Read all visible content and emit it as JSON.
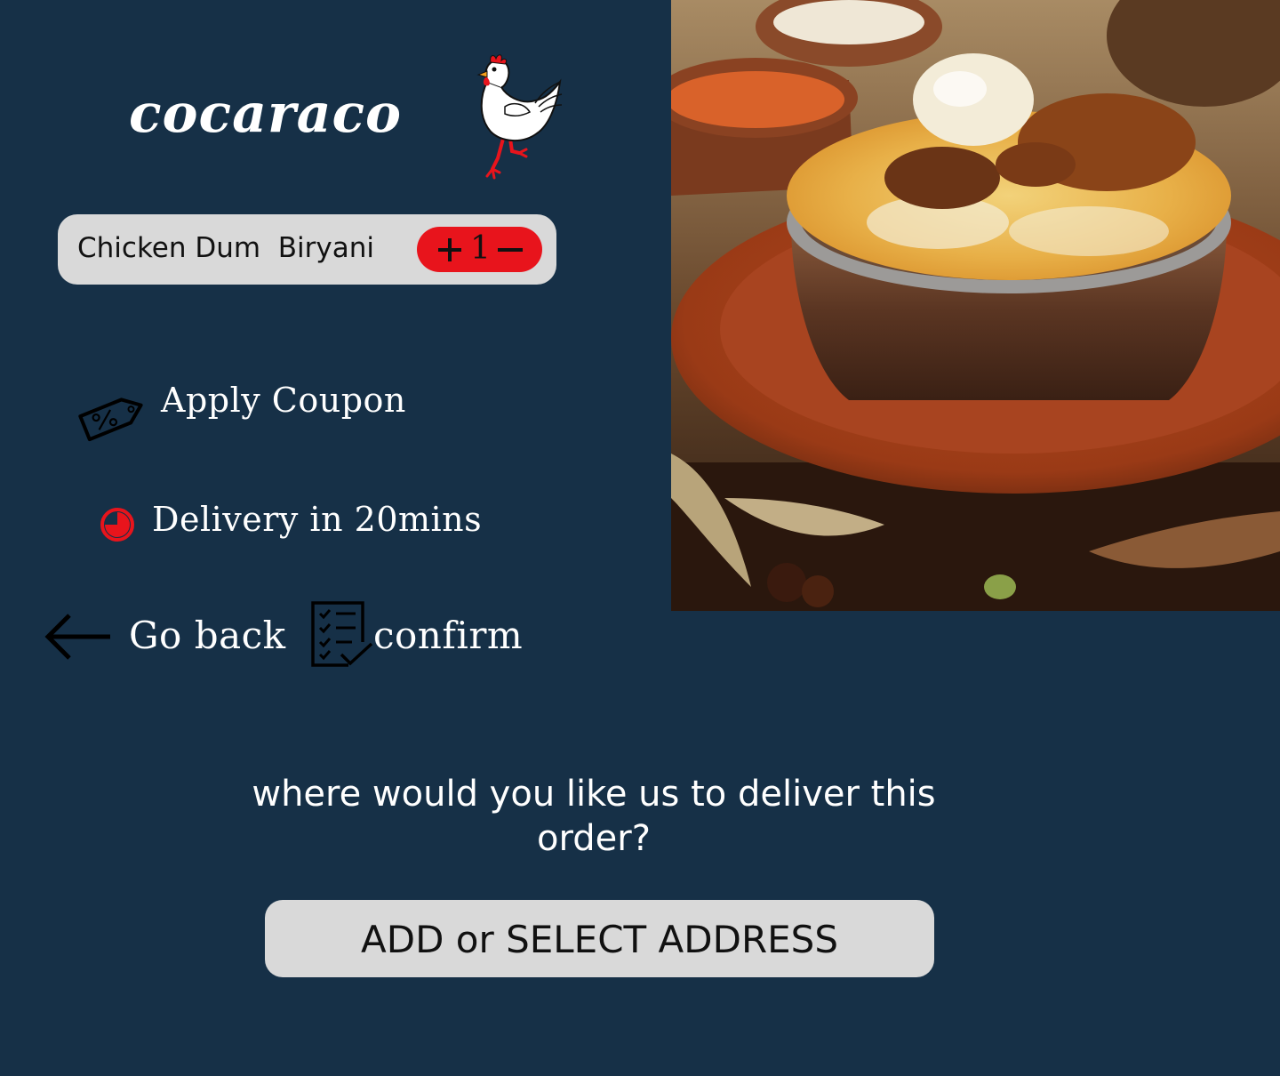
{
  "brand": {
    "name": "cocaraco",
    "mascot": "rooster-icon"
  },
  "cart": {
    "item_name": "Chicken Dum  Biryani",
    "quantity": "1",
    "plus_icon": "plus-icon",
    "minus_icon": "minus-icon"
  },
  "coupon": {
    "label": "Apply Coupon",
    "icon": "coupon-tag-icon"
  },
  "delivery": {
    "label": "Delivery in 20mins",
    "icon": "clock-icon"
  },
  "actions": {
    "back_label": "Go back",
    "back_icon": "arrow-left-icon",
    "confirm_label": "confirm",
    "confirm_icon": "checklist-icon"
  },
  "address": {
    "prompt": "where would you like us to deliver this order?",
    "button_label": "ADD or SELECT ADDRESS"
  },
  "colors": {
    "background": "#163047",
    "card": "#d9d9d9",
    "accent": "#e8141c",
    "text_light": "#ffffff",
    "text_dark": "#111111"
  }
}
